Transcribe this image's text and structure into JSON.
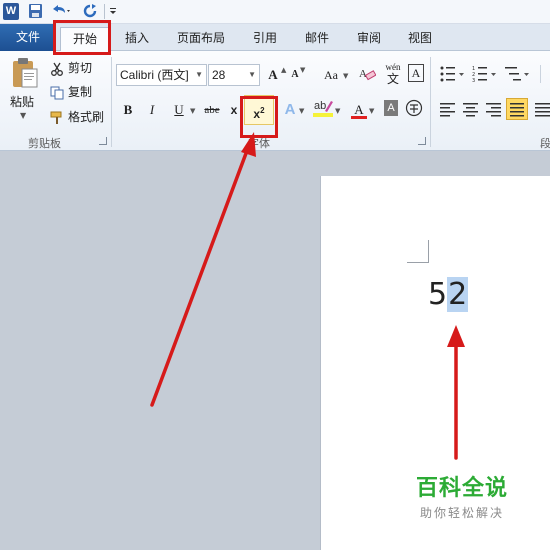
{
  "tabs": {
    "file": "文件",
    "home": "开始",
    "insert": "插入",
    "layout": "页面布局",
    "references": "引用",
    "mailings": "邮件",
    "review": "审阅",
    "view": "视图"
  },
  "clipboard": {
    "paste": "粘贴",
    "cut": "剪切",
    "copy": "复制",
    "format_painter": "格式刷",
    "group_label": "剪贴板"
  },
  "font": {
    "font_name": "Calibri (西文]",
    "font_size": "28",
    "grow": "A",
    "shrink": "A",
    "change_case": "Aa",
    "bold": "B",
    "italic": "I",
    "underline": "U",
    "strikethrough": "abe",
    "subscript": "x",
    "superscript_base": "x",
    "superscript_exp": "2",
    "text_effect": "A",
    "font_color_glyph": "A",
    "shading": "A",
    "border_char": "A",
    "phonetic_top": "wén",
    "phonetic_bottom": "文",
    "group_label": "字体"
  },
  "paragraph": {
    "group_label": "段"
  },
  "document": {
    "base": "5",
    "selected": "2"
  },
  "watermark": {
    "title": "百科全说",
    "subtitle": "助你轻松解决"
  },
  "colors": {
    "accent_red": "#d61a1a",
    "file_tab": "#2b62a8",
    "selection": "#b9d4f2",
    "watermark_green": "#2cab35"
  }
}
